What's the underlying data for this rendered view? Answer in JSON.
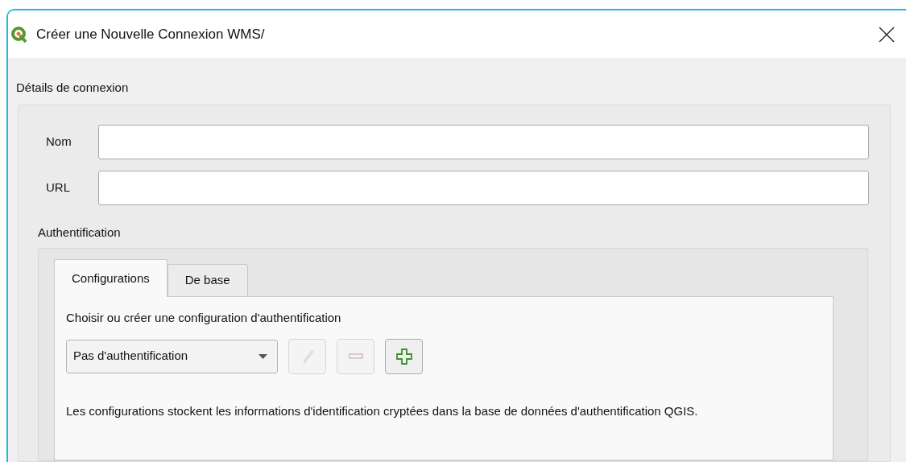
{
  "window": {
    "title": "Créer une Nouvelle Connexion WMS/"
  },
  "connection_details": {
    "title": "Détails de connexion",
    "fields": [
      {
        "label": "Nom"
      },
      {
        "label": "URL"
      }
    ]
  },
  "authentication": {
    "title": "Authentification",
    "tabs": [
      {
        "label": "Configurations",
        "selected": true
      },
      {
        "label": "De base",
        "selected": false
      }
    ],
    "prompt": "Choisir ou créer une configuration d'authentification",
    "config_select": {
      "value": "Pas d'authentification"
    },
    "tool_buttons": [
      {
        "kind": "edit",
        "disabled": true
      },
      {
        "kind": "remove",
        "disabled": true
      },
      {
        "kind": "add",
        "disabled": false
      }
    ],
    "description": "Les configurations stockent les informations d'identification cryptées dans la base de données d'authentification QGIS."
  }
}
